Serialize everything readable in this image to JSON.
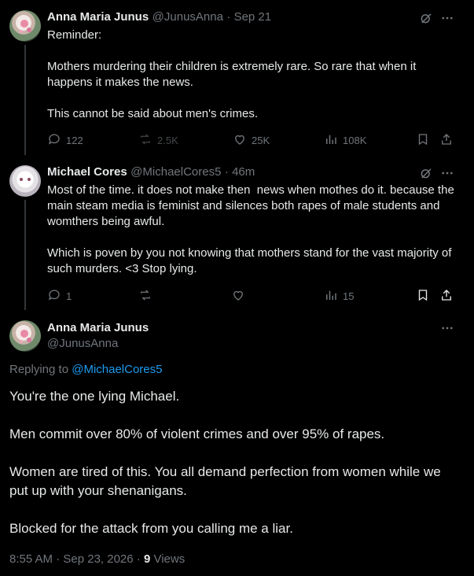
{
  "tweet1": {
    "author_name": "Anna Maria Junus",
    "handle": "@JunusAnna",
    "time": "· Sep 21",
    "text": "Reminder:\n\nMothers murdering their children is extremely rare. So rare that when it happens it makes the news.\n\nThis cannot be said about men's crimes.",
    "replies": "122",
    "reposts": "2.5K",
    "likes": "25K",
    "views": "108K"
  },
  "tweet2": {
    "author_name": "Michael Cores",
    "handle": "@MichaelCores5",
    "time": "· 46m",
    "text": "Most of the time. it does not make then  news when mothes do it. because the main steam media is feminist and silences both rapes of male students and womthers being awful.\n\nWhich is poven by you not knowing that mothers stand for the vast majority of such murders. <3 Stop lying.",
    "replies": "1",
    "views": "15"
  },
  "tweet3": {
    "author_name": "Anna Maria Junus",
    "handle": "@JunusAnna",
    "replying_label": "Replying to",
    "replying_to": "@MichaelCores5",
    "text": "You're the one lying Michael.\n\nMen commit over 80% of violent crimes and over 95% of rapes.\n\nWomen are tired of this. You all demand perfection from women while we put up with your shenanigans.\n\nBlocked for the attack from you calling me a liar.",
    "timestamp": "8:55 AM · Sep 23, 2026 ·",
    "views_count": "9",
    "views_label": "Views"
  },
  "icons": {
    "grok": "grok-icon",
    "more": "more-icon",
    "reply": "reply-icon",
    "repost": "repost-icon",
    "like": "heart-icon",
    "views": "views-icon",
    "bookmark": "bookmark-icon",
    "share": "share-icon"
  },
  "colors": {
    "background": "#000000",
    "text": "#e7e9ea",
    "muted": "#71767b",
    "link": "#1d9bf0"
  }
}
